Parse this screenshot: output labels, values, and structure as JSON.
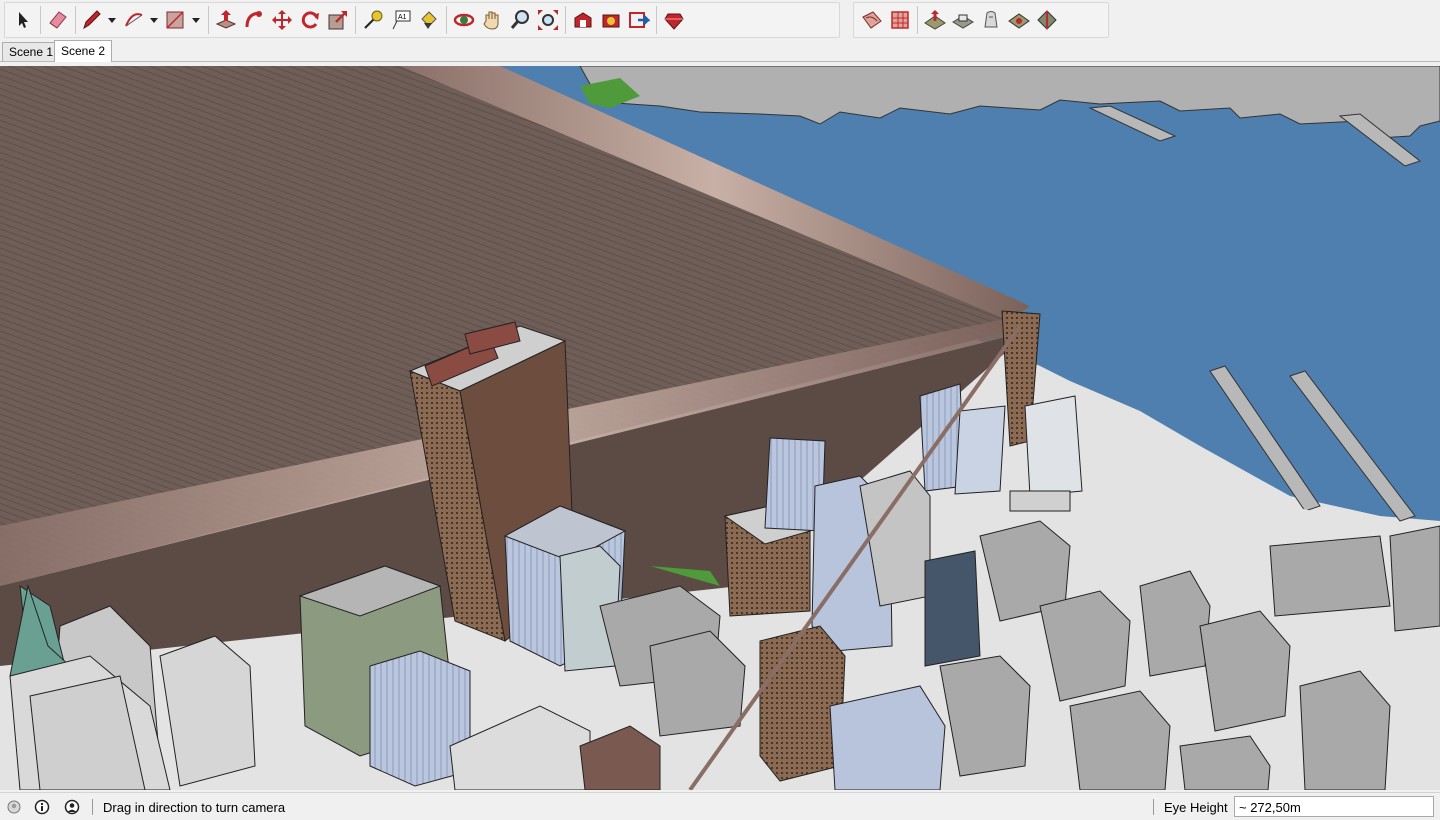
{
  "toolbar": {
    "groups": [
      {
        "id": "main",
        "tools": [
          "select-icon",
          "eraser-icon",
          "pencil-icon",
          "arc-icon",
          "rectangle-icon",
          "push-pull-icon",
          "follow-me-icon",
          "move-icon",
          "rotate-icon",
          "scale-icon",
          "tape-measure-icon",
          "text-icon",
          "paint-bucket-icon",
          "orbit-icon",
          "pan-icon",
          "zoom-icon",
          "zoom-extents-icon",
          "warehouse-icon",
          "extension-warehouse-icon",
          "share-model-icon",
          "ruby-icon"
        ]
      },
      {
        "id": "sandbox",
        "tools": [
          "sandbox-contours-icon",
          "sandbox-scratch-icon",
          "smoove-icon",
          "stamp-icon",
          "drape-icon",
          "add-detail-icon",
          "flip-edge-icon"
        ]
      }
    ]
  },
  "tabs": [
    {
      "label": "Scene 1",
      "active": false
    },
    {
      "label": "Scene 2",
      "active": true
    }
  ],
  "status": {
    "message": "Drag in direction to turn camera",
    "eye_height_label": "Eye Height",
    "eye_height_value": "~ 272,50m"
  },
  "colors": {
    "water": "#4f7fae",
    "ground": "#e4e4e4",
    "building_gray": "#a9a9a9",
    "roof": "#6d5a55",
    "tool_red": "#c0272d"
  }
}
